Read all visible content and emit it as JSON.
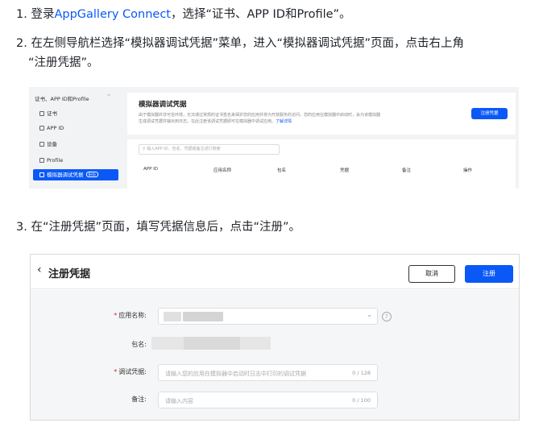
{
  "steps": [
    {
      "num": "1.",
      "before": "登录",
      "link": "AppGallery Connect",
      "after": "，选择“证书、APP ID和Profile”。"
    },
    {
      "num": "2.",
      "line1": "在左侧导航栏选择“模拟器调试凭据”菜单，进入“模拟器调试凭据”页面，点击右上角",
      "line2": "“注册凭据”。"
    },
    {
      "num": "3.",
      "text": "在“注册凭据”页面，填写凭据信息后，点击“注册”。"
    }
  ],
  "screenshot1": {
    "sidebar": {
      "group_label": "证书、APP ID和Profile",
      "items": [
        "证书",
        "APP ID",
        "设备",
        "Profile",
        "模拟器调试凭据"
      ],
      "active_badge": "Beta"
    },
    "page_title": "模拟器调试凭据",
    "description_line1": "由于模拟器并非可信环境，无法通过常规的证书签名来保护您的应用并将为开放服务的访问。您的应用在模拟器中启动时，会为该模拟器",
    "description_line2": "生成调试凭据并输出到日志。在此注册该调试凭据即可在模拟器中调试应用。",
    "description_link": "了解详情",
    "register_button": "注册凭据",
    "search_placeholder": "输入APP ID、包名、凭据或备注进行搜索",
    "table_headers": [
      "APP ID",
      "应用名称",
      "包名",
      "凭据",
      "备注",
      "操作"
    ]
  },
  "screenshot2": {
    "title": "注册凭据",
    "cancel_button": "取消",
    "submit_button": "注册",
    "fields": {
      "app_name_label": "应用名称:",
      "package_label": "包名:",
      "credential_label": "调试凭据:",
      "credential_placeholder": "请输入您的应用在模拟器中启动时日志中打印的调试凭据",
      "credential_count": "0 / 128",
      "remark_label": "备注:",
      "remark_placeholder": "请输入内容",
      "remark_count": "0 / 100",
      "required_mark": "*"
    }
  },
  "colors": {
    "link": "#0a59f7",
    "primary": "#0a59f7",
    "required": "#e02020"
  }
}
